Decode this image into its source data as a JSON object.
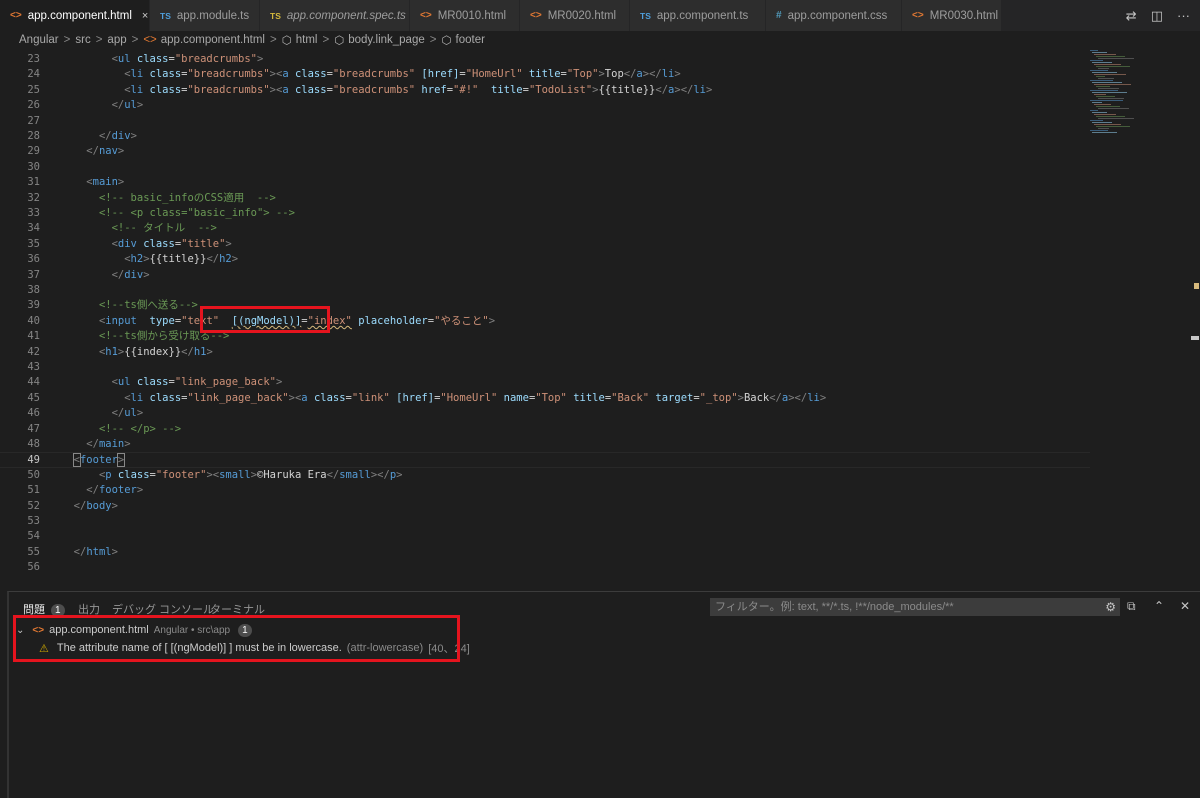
{
  "tabs": [
    {
      "icon": "html",
      "icon_text": "<>",
      "label": "app.component.html",
      "active": true,
      "close": "×"
    },
    {
      "icon": "ts",
      "icon_text": "TS",
      "label": "app.module.ts"
    },
    {
      "icon": "spec",
      "icon_text": "TS",
      "label": "app.component.spec.ts",
      "italic": true
    },
    {
      "icon": "html",
      "icon_text": "<>",
      "label": "MR0010.html"
    },
    {
      "icon": "html",
      "icon_text": "<>",
      "label": "MR0020.html"
    },
    {
      "icon": "ts",
      "icon_text": "TS",
      "label": "app.component.ts"
    },
    {
      "icon": "css",
      "icon_text": "#",
      "label": "app.component.css"
    },
    {
      "icon": "html",
      "icon_text": "<>",
      "label": "MR0030.html"
    }
  ],
  "tab_actions": [
    "⇄",
    "◫",
    "···"
  ],
  "breadcrumb": [
    {
      "label": "Angular"
    },
    {
      "label": "src"
    },
    {
      "label": "app"
    },
    {
      "label": "app.component.html",
      "icon": "<>"
    },
    {
      "label": "html",
      "icon": "⬡"
    },
    {
      "label": "body.link_page",
      "icon": "⬡"
    },
    {
      "label": "footer",
      "icon": "⬡"
    }
  ],
  "breadcrumb_sep": ">",
  "editor": {
    "current_line": 49,
    "lines": [
      {
        "n": 23,
        "code": "        <span class=\"p\">&lt;</span><span class=\"t\">ul</span> <span class=\"a\">class</span>=<span class=\"s\">\"breadcrumbs\"</span><span class=\"p\">&gt;</span>"
      },
      {
        "n": 24,
        "code": "          <span class=\"p\">&lt;</span><span class=\"t\">li</span> <span class=\"a\">class</span>=<span class=\"s\">\"breadcrumbs\"</span><span class=\"p\">&gt;&lt;</span><span class=\"t\">a</span> <span class=\"a\">class</span>=<span class=\"s\">\"breadcrumbs\"</span> <span class=\"a\">[href]</span>=<span class=\"s\">\"HomeUrl\"</span> <span class=\"a\">title</span>=<span class=\"s\">\"Top\"</span><span class=\"p\">&gt;</span>Top<span class=\"p\">&lt;/</span><span class=\"t\">a</span><span class=\"p\">&gt;&lt;/</span><span class=\"t\">li</span><span class=\"p\">&gt;</span>"
      },
      {
        "n": 25,
        "code": "          <span class=\"p\">&lt;</span><span class=\"t\">li</span> <span class=\"a\">class</span>=<span class=\"s\">\"breadcrumbs\"</span><span class=\"p\">&gt;&lt;</span><span class=\"t\">a</span> <span class=\"a\">class</span>=<span class=\"s\">\"breadcrumbs\"</span> <span class=\"a\">href</span>=<span class=\"s\">\"#!\"</span>  <span class=\"a\">title</span>=<span class=\"s\">\"TodoList\"</span><span class=\"p\">&gt;</span>{{title}}<span class=\"p\">&lt;/</span><span class=\"t\">a</span><span class=\"p\">&gt;&lt;/</span><span class=\"t\">li</span><span class=\"p\">&gt;</span>"
      },
      {
        "n": 26,
        "code": "        <span class=\"p\">&lt;/</span><span class=\"t\">ul</span><span class=\"p\">&gt;</span>"
      },
      {
        "n": 27,
        "code": ""
      },
      {
        "n": 28,
        "code": "      <span class=\"p\">&lt;/</span><span class=\"t\">div</span><span class=\"p\">&gt;</span>"
      },
      {
        "n": 29,
        "code": "    <span class=\"p\">&lt;/</span><span class=\"t\">nav</span><span class=\"p\">&gt;</span>"
      },
      {
        "n": 30,
        "code": ""
      },
      {
        "n": 31,
        "code": "    <span class=\"p\">&lt;</span><span class=\"t\">main</span><span class=\"p\">&gt;</span>"
      },
      {
        "n": 32,
        "code": "      <span class=\"c\">&lt;!-- basic_infoのCSS適用  --&gt;</span>"
      },
      {
        "n": 33,
        "code": "      <span class=\"c\">&lt;!-- &lt;p class=\"basic_info\"&gt; --&gt;</span>"
      },
      {
        "n": 34,
        "code": "        <span class=\"c\">&lt;!-- タイトル  --&gt;</span>"
      },
      {
        "n": 35,
        "code": "        <span class=\"p\">&lt;</span><span class=\"t\">div</span> <span class=\"a\">class</span>=<span class=\"s\">\"title\"</span><span class=\"p\">&gt;</span>"
      },
      {
        "n": 36,
        "code": "          <span class=\"p\">&lt;</span><span class=\"t\">h2</span><span class=\"p\">&gt;</span>{{title}}<span class=\"p\">&lt;/</span><span class=\"t\">h2</span><span class=\"p\">&gt;</span>"
      },
      {
        "n": 37,
        "code": "        <span class=\"p\">&lt;/</span><span class=\"t\">div</span><span class=\"p\">&gt;</span>"
      },
      {
        "n": 38,
        "code": ""
      },
      {
        "n": 39,
        "code": "      <span class=\"c\">&lt;!--ts側へ送る--&gt;</span>"
      },
      {
        "n": 40,
        "code": "      <span class=\"p\">&lt;</span><span class=\"t\">input</span>  <span class=\"a\">type</span>=<span class=\"s\">\"text\"</span>  <span class=\"a squig\">[(ngModel)]</span>=<span class=\"s squig\">\"index\"</span> <span class=\"a\">placeholder</span>=<span class=\"s\">\"やること\"</span><span class=\"p\">&gt;</span>"
      },
      {
        "n": 41,
        "code": "      <span class=\"c\">&lt;!--ts側から受け取る--&gt;</span>"
      },
      {
        "n": 42,
        "code": "      <span class=\"p\">&lt;</span><span class=\"t\">h1</span><span class=\"p\">&gt;</span>{{index}}<span class=\"p\">&lt;/</span><span class=\"t\">h1</span><span class=\"p\">&gt;</span>"
      },
      {
        "n": 43,
        "code": ""
      },
      {
        "n": 44,
        "code": "        <span class=\"p\">&lt;</span><span class=\"t\">ul</span> <span class=\"a\">class</span>=<span class=\"s\">\"link_page_back\"</span><span class=\"p\">&gt;</span>"
      },
      {
        "n": 45,
        "code": "          <span class=\"p\">&lt;</span><span class=\"t\">li</span> <span class=\"a\">class</span>=<span class=\"s\">\"link_page_back\"</span><span class=\"p\">&gt;&lt;</span><span class=\"t\">a</span> <span class=\"a\">class</span>=<span class=\"s\">\"link\"</span> <span class=\"a\">[href]</span>=<span class=\"s\">\"HomeUrl\"</span> <span class=\"a\">name</span>=<span class=\"s\">\"Top\"</span> <span class=\"a\">title</span>=<span class=\"s\">\"Back\"</span> <span class=\"a\">target</span>=<span class=\"s\">\"_top\"</span><span class=\"p\">&gt;</span>Back<span class=\"p\">&lt;/</span><span class=\"t\">a</span><span class=\"p\">&gt;&lt;/</span><span class=\"t\">li</span><span class=\"p\">&gt;</span>"
      },
      {
        "n": 46,
        "code": "        <span class=\"p\">&lt;/</span><span class=\"t\">ul</span><span class=\"p\">&gt;</span>"
      },
      {
        "n": 47,
        "code": "      <span class=\"c\">&lt;!-- &lt;/p&gt; --&gt;</span>"
      },
      {
        "n": 48,
        "code": "    <span class=\"p\">&lt;/</span><span class=\"t\">main</span><span class=\"p\">&gt;</span>"
      },
      {
        "n": 49,
        "code": "  <span class=\"p\" style=\"outline:1px solid #888\">&lt;</span><span class=\"t\">footer</span><span class=\"p\" style=\"outline:1px solid #888\">&gt;</span>"
      },
      {
        "n": 50,
        "code": "      <span class=\"p\">&lt;</span><span class=\"t\">p</span> <span class=\"a\">class</span>=<span class=\"s\">\"footer\"</span><span class=\"p\">&gt;&lt;</span><span class=\"t\">small</span><span class=\"p\">&gt;</span>©Haruka Era<span class=\"p\">&lt;/</span><span class=\"t\">small</span><span class=\"p\">&gt;&lt;/</span><span class=\"t\">p</span><span class=\"p\">&gt;</span>"
      },
      {
        "n": 51,
        "code": "    <span class=\"p\">&lt;/</span><span class=\"t\">footer</span><span class=\"p\">&gt;</span>"
      },
      {
        "n": 52,
        "code": "  <span class=\"p\">&lt;/</span><span class=\"t\">body</span><span class=\"p\">&gt;</span>"
      },
      {
        "n": 53,
        "code": ""
      },
      {
        "n": 54,
        "code": ""
      },
      {
        "n": 55,
        "code": "  <span class=\"p\">&lt;/</span><span class=\"t\">html</span><span class=\"p\">&gt;</span>"
      },
      {
        "n": 56,
        "code": ""
      }
    ]
  },
  "panel": {
    "tabs": [
      {
        "label": "問題",
        "active": true
      },
      {
        "label": "出力"
      },
      {
        "label": "デバッグ コンソール"
      },
      {
        "label": "ターミナル"
      }
    ],
    "problems_count": "1",
    "filter_placeholder": "フィルター。例: text, **/*.ts, !**/node_modules/**",
    "actions": [
      "⧉",
      "⌃",
      "✕"
    ],
    "file": {
      "chevron": "⌄",
      "icon_text": "<>",
      "name": "app.component.html",
      "path": "Angular • src\\app",
      "count": "1"
    },
    "problem": {
      "icon": "⚠",
      "message": "The attribute name of [ [(ngModel)] ] must be in lowercase.",
      "rule": "(attr-lowercase)",
      "location": "[40、24]"
    }
  },
  "colors": {
    "highlight": "#e5141e",
    "warning": "#cca700"
  }
}
